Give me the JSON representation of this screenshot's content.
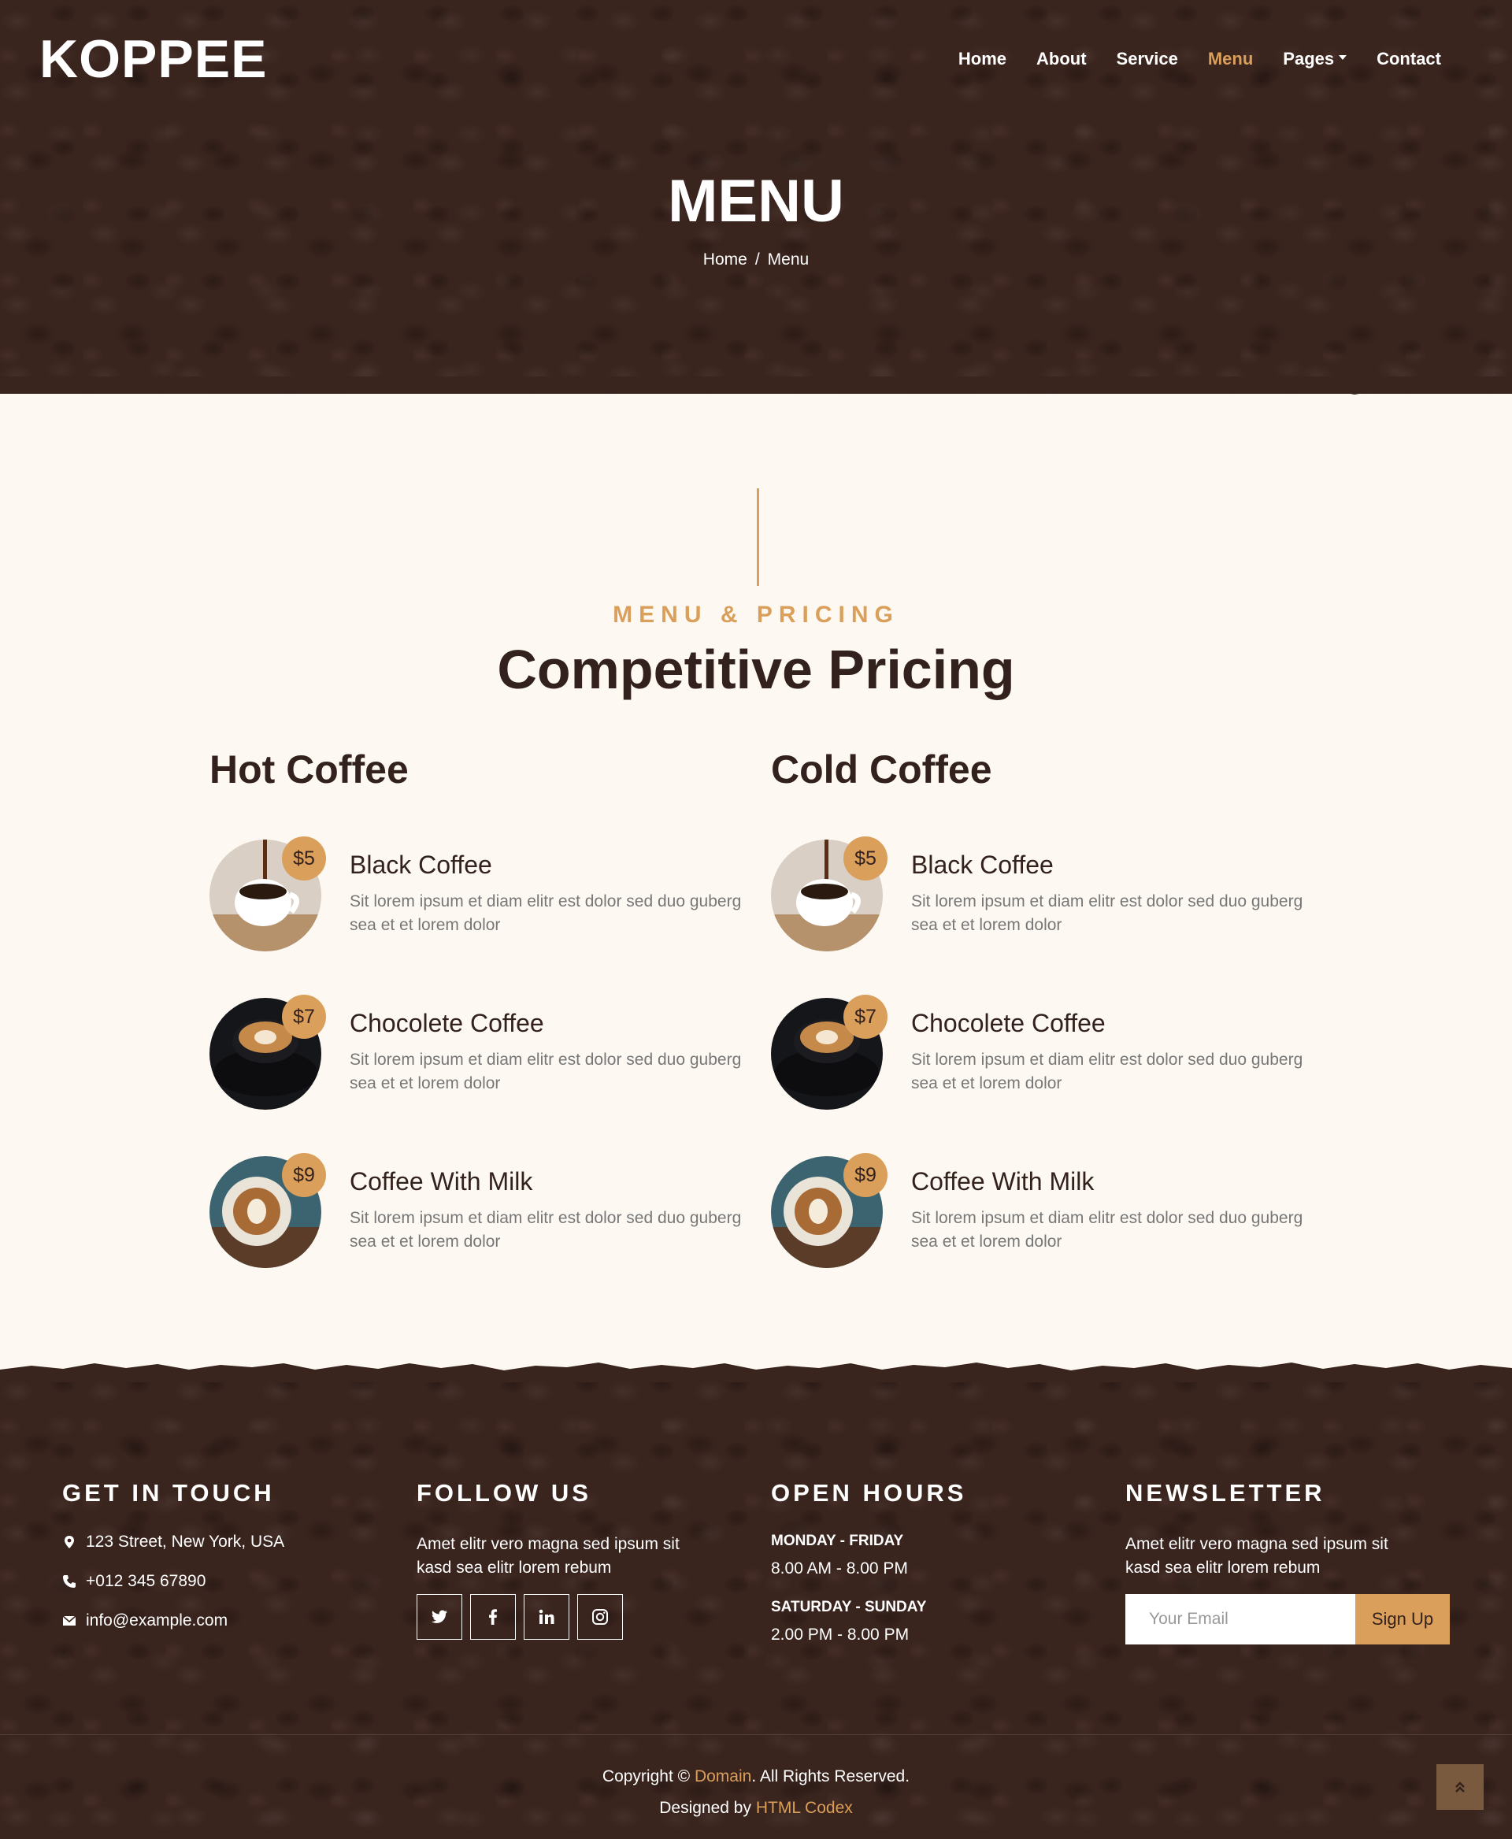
{
  "brand": {
    "logo": "KOPPEE"
  },
  "nav": {
    "items": [
      {
        "label": "Home"
      },
      {
        "label": "About"
      },
      {
        "label": "Service"
      },
      {
        "label": "Menu",
        "active": true
      },
      {
        "label": "Pages",
        "dropdown": true
      },
      {
        "label": "Contact"
      }
    ]
  },
  "hero": {
    "title": "MENU",
    "breadcrumb": {
      "home": "Home",
      "separator": "/",
      "current": "Menu"
    }
  },
  "menu": {
    "subtitle": "MENU & PRICING",
    "title": "Competitive Pricing",
    "hot": {
      "title": "Hot Coffee",
      "items": [
        {
          "price": "$5",
          "name": "Black Coffee",
          "desc": "Sit lorem ipsum et diam elitr est dolor sed duo guberg sea et et lorem dolor"
        },
        {
          "price": "$7",
          "name": "Chocolete Coffee",
          "desc": "Sit lorem ipsum et diam elitr est dolor sed duo guberg sea et et lorem dolor"
        },
        {
          "price": "$9",
          "name": "Coffee With Milk",
          "desc": "Sit lorem ipsum et diam elitr est dolor sed duo guberg sea et et lorem dolor"
        }
      ]
    },
    "cold": {
      "title": "Cold Coffee",
      "items": [
        {
          "price": "$5",
          "name": "Black Coffee",
          "desc": "Sit lorem ipsum et diam elitr est dolor sed duo guberg sea et et lorem dolor"
        },
        {
          "price": "$7",
          "name": "Chocolete Coffee",
          "desc": "Sit lorem ipsum et diam elitr est dolor sed duo guberg sea et et lorem dolor"
        },
        {
          "price": "$9",
          "name": "Coffee With Milk",
          "desc": "Sit lorem ipsum et diam elitr est dolor sed duo guberg sea et et lorem dolor"
        }
      ]
    }
  },
  "footer": {
    "contact": {
      "title": "GET IN TOUCH",
      "address": "123 Street, New York, USA",
      "phone": "+012 345 67890",
      "email": "info@example.com"
    },
    "follow": {
      "title": "FOLLOW US",
      "text": "Amet elitr vero magna sed ipsum sit kasd sea elitr lorem rebum",
      "icons": [
        "twitter-icon",
        "facebook-icon",
        "linkedin-icon",
        "instagram-icon"
      ]
    },
    "hours": {
      "title": "OPEN HOURS",
      "weekday_label": "MONDAY - FRIDAY",
      "weekday_time": "8.00 AM - 8.00 PM",
      "weekend_label": "SATURDAY - SUNDAY",
      "weekend_time": "2.00 PM - 8.00 PM"
    },
    "newsletter": {
      "title": "NEWSLETTER",
      "text": "Amet elitr vero magna sed ipsum sit kasd sea elitr lorem rebum",
      "placeholder": "Your Email",
      "button": "Sign Up"
    },
    "copyright": {
      "prefix": "Copyright ©",
      "domain": "Domain",
      "suffix": ". All Rights Reserved.",
      "designed_prefix": "Designed by",
      "designer": "HTML Codex"
    }
  },
  "colors": {
    "accent": "#da9f5b",
    "dark": "#33211d",
    "bg": "#fdf9f2"
  }
}
